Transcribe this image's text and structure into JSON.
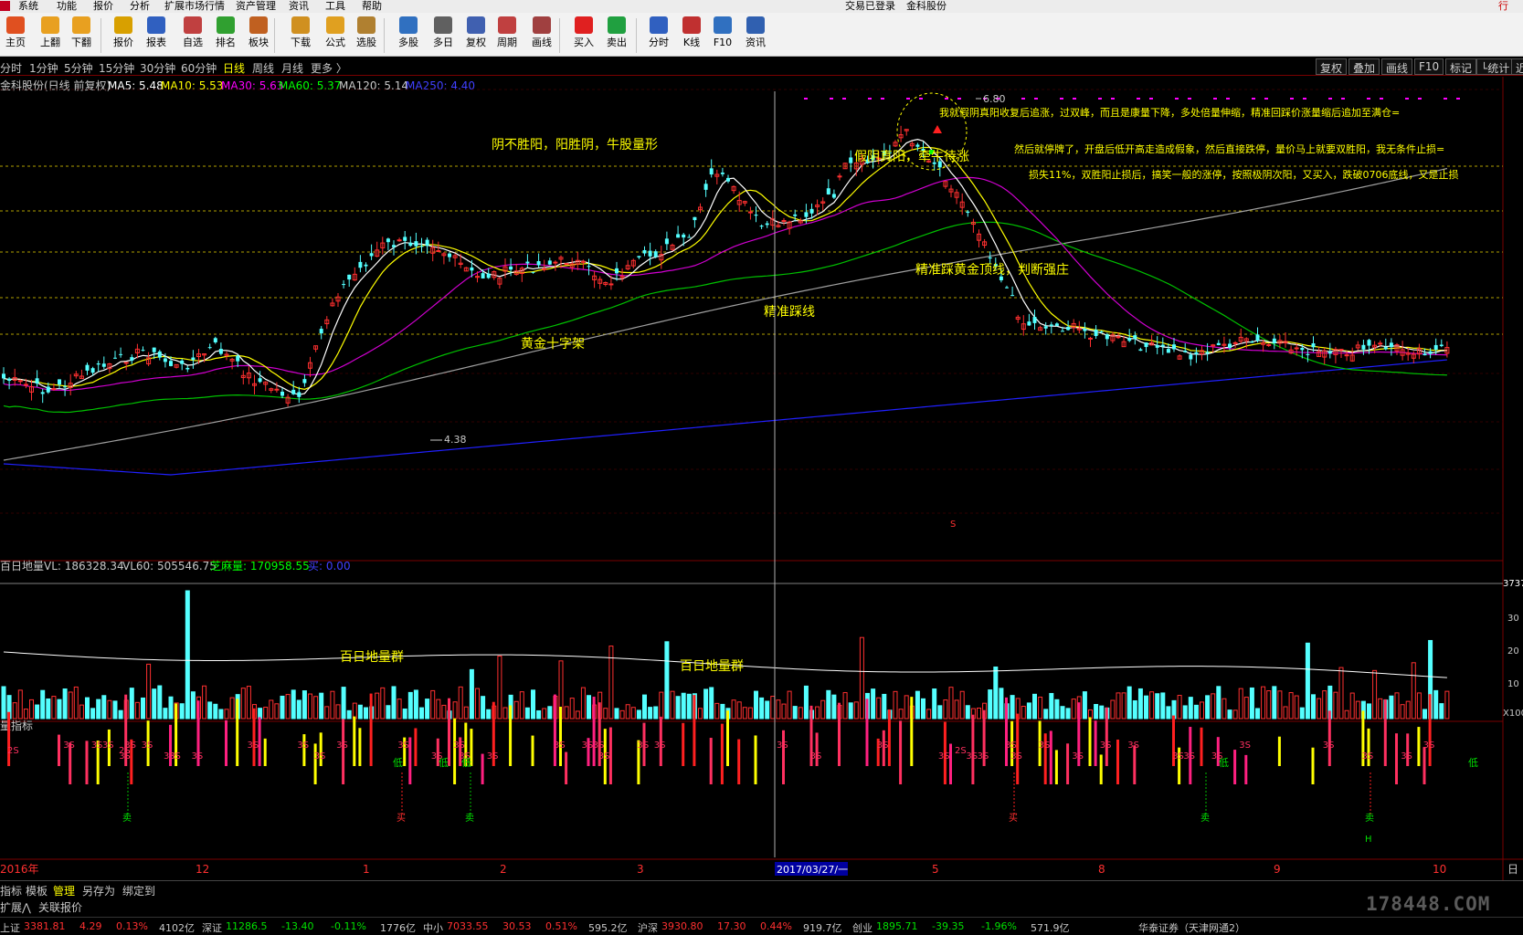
{
  "menubar": {
    "items": [
      "系统",
      "功能",
      "报价",
      "分析",
      "扩展市场行情",
      "资产管理",
      "资讯",
      "工具",
      "帮助"
    ],
    "status_login": "交易已登录",
    "stock_name": "金科股份",
    "corner": "行"
  },
  "toolbar": {
    "buttons": [
      {
        "label": "主页",
        "icon": "home-icon",
        "color": "#e05020"
      },
      {
        "label": "上翻",
        "icon": "up-arrow-icon",
        "color": "#e8a020"
      },
      {
        "label": "下翻",
        "icon": "down-arrow-icon",
        "color": "#e8a020"
      },
      {
        "label": "报价",
        "icon": "yuan-icon",
        "color": "#d8a000"
      },
      {
        "label": "报表",
        "icon": "report-icon",
        "color": "#3060c0"
      },
      {
        "label": "自选",
        "icon": "f6-icon",
        "color": "#c04040"
      },
      {
        "label": "排名",
        "icon": "ranking-icon",
        "color": "#30a030"
      },
      {
        "label": "板块",
        "icon": "sector-icon",
        "color": "#c06020"
      },
      {
        "label": "下载",
        "icon": "download-icon",
        "color": "#d09020"
      },
      {
        "label": "公式",
        "icon": "formula-icon",
        "color": "#e0a020"
      },
      {
        "label": "选股",
        "icon": "pick-stock-icon",
        "color": "#b08030"
      },
      {
        "label": "多股",
        "icon": "multi-stock-icon",
        "color": "#3070c0"
      },
      {
        "label": "多日",
        "icon": "multi-day-icon",
        "color": "#606060"
      },
      {
        "label": "复权",
        "icon": "adjust-icon",
        "color": "#4060b0"
      },
      {
        "label": "周期",
        "icon": "f8-icon",
        "color": "#c04040"
      },
      {
        "label": "画线",
        "icon": "draw-line-icon",
        "color": "#a04040"
      },
      {
        "label": "买入",
        "icon": "buy-icon",
        "color": "#e02020"
      },
      {
        "label": "卖出",
        "icon": "sell-icon",
        "color": "#20a040"
      },
      {
        "label": "分时",
        "icon": "intraday-icon",
        "color": "#3060c0"
      },
      {
        "label": "K线",
        "icon": "kline-icon",
        "color": "#c03030"
      },
      {
        "label": "F10",
        "icon": "f10-icon",
        "color": "#3070c0"
      },
      {
        "label": "资讯",
        "icon": "news-icon",
        "color": "#3060b0"
      }
    ]
  },
  "periodbar": {
    "periods": [
      "分时",
      "1分钟",
      "5分钟",
      "15分钟",
      "30分钟",
      "60分钟",
      "日线",
      "周线",
      "月线",
      "更多 〉"
    ],
    "active": "日线",
    "right_buttons": [
      "复权",
      "叠加",
      "画线",
      "F10",
      "标记",
      "└统计",
      "近"
    ]
  },
  "main_chart": {
    "header_label": "金科股份(日线 前复权)",
    "ma_items": [
      {
        "label": "MA5: 5.48",
        "color": "#ffffff"
      },
      {
        "label": "MA10: 5.53",
        "color": "#ffff00"
      },
      {
        "label": "MA30: 5.63",
        "color": "#ff00ff"
      },
      {
        "label": "MA60: 5.37",
        "color": "#00ff00"
      },
      {
        "label": "MA120: 5.14",
        "color": "#c8c8c8"
      },
      {
        "label": "MA250: 4.40",
        "color": "#4040ff"
      }
    ],
    "high_label": "6.80",
    "low_label": "4.38",
    "s_marker": "S",
    "annotations": {
      "a1": "阴不胜阳，阳胜阴，牛股量形",
      "a2": "假阴真阳，牵牛待涨",
      "a3": "我就假阴真阳收复后追涨，过双峰，而且是康量下降，多处倍量伸缩，精准回踩价涨量缩后追加至满仓=",
      "a4": "然后就停牌了，开盘后低开高走造成假象，然后直接跌停，量价马上就要双胜阳，我无条件止损=",
      "a5": "损失11%，双胜阳止损后，搞笑一般的涨停，按照极阴次阳，又买入，跌破0706底线，又是止损",
      "a6": "精准踩黄金顶线，判断强庄",
      "a7": "精准踩线",
      "a8": "黄金十字架"
    }
  },
  "volume_chart": {
    "header_label": "百日地量",
    "items": [
      {
        "label": "VL: 186328.34",
        "color": "#c8c8c8"
      },
      {
        "label": "VL60: 505546.75",
        "color": "#c8c8c8"
      },
      {
        "label": "芝麻量: 170958.55",
        "color": "#00ff00"
      },
      {
        "label": "买: 0.00",
        "color": "#4040ff"
      }
    ],
    "annotations": [
      "百日地量群",
      "百日地量群"
    ],
    "scale": [
      "3737",
      "30",
      "20",
      "10",
      "X100"
    ]
  },
  "indicator_chart": {
    "header_label": "量指标",
    "labels": {
      "s3": "3S",
      "s2": "2S",
      "low": "低",
      "sell": "卖",
      "buy": "买",
      "h": "H"
    }
  },
  "date_axis": {
    "labels": [
      "2016年",
      "12",
      "1",
      "2",
      "3",
      "5",
      "8",
      "9",
      "10"
    ],
    "cursor_date": "2017/03/27/一",
    "right_label": "日"
  },
  "bottom_tabs": {
    "row1": [
      "指标",
      "模板",
      "管理",
      "另存为",
      "绑定到"
    ],
    "row1_active": "管理",
    "row2": [
      "扩展⋀",
      "关联报价"
    ]
  },
  "statusbar": {
    "items": [
      {
        "text": "上证",
        "color": "#c8c8c8"
      },
      {
        "text": "3381.81",
        "color": "#ff3030"
      },
      {
        "text": "4.29",
        "color": "#ff3030"
      },
      {
        "text": "0.13%",
        "color": "#ff3030"
      },
      {
        "text": "4102亿",
        "color": "#c8c8c8"
      },
      {
        "text": "深证",
        "color": "#c8c8c8"
      },
      {
        "text": "11286.5",
        "color": "#00e000"
      },
      {
        "text": "-13.40",
        "color": "#00e000"
      },
      {
        "text": "-0.11%",
        "color": "#00e000"
      },
      {
        "text": "1776亿",
        "color": "#c8c8c8"
      },
      {
        "text": "中小",
        "color": "#c8c8c8"
      },
      {
        "text": "7033.55",
        "color": "#ff3030"
      },
      {
        "text": "30.53",
        "color": "#ff3030"
      },
      {
        "text": "0.51%",
        "color": "#ff3030"
      },
      {
        "text": "595.2亿",
        "color": "#c8c8c8"
      },
      {
        "text": "沪深",
        "color": "#c8c8c8"
      },
      {
        "text": "3930.80",
        "color": "#ff3030"
      },
      {
        "text": "17.30",
        "color": "#ff3030"
      },
      {
        "text": "0.44%",
        "color": "#ff3030"
      },
      {
        "text": "919.7亿",
        "color": "#c8c8c8"
      },
      {
        "text": "创业",
        "color": "#c8c8c8"
      },
      {
        "text": "1895.71",
        "color": "#00e000"
      },
      {
        "text": "-39.35",
        "color": "#00e000"
      },
      {
        "text": "-1.96%",
        "color": "#00e000"
      },
      {
        "text": "571.9亿",
        "color": "#c8c8c8"
      }
    ],
    "server": "华泰证券（天津网通2）"
  },
  "watermark": "178448.COM"
}
